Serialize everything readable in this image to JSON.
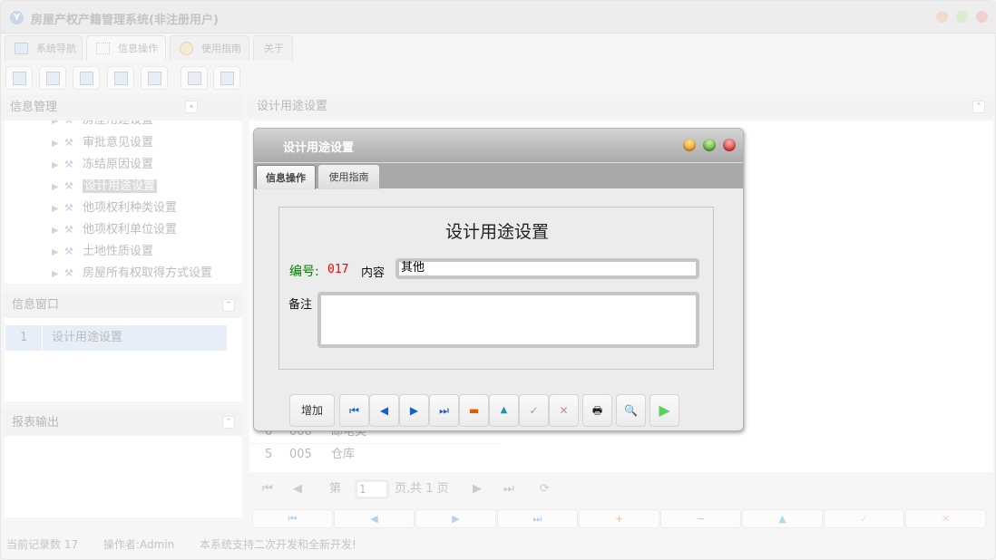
{
  "app": {
    "title": "房屋产权产籍管理系统(非注册用户)"
  },
  "tabs": [
    {
      "label": "系统导航"
    },
    {
      "label": "信息操作"
    },
    {
      "label": "使用指南"
    },
    {
      "label": "关于"
    }
  ],
  "left": {
    "info_mgmt": {
      "title": "信息管理"
    },
    "tree": [
      {
        "label": "审批意见设置"
      },
      {
        "label": "冻结原因设置"
      },
      {
        "label": "设计用途设置",
        "selected": true
      },
      {
        "label": "他项权利种类设置"
      },
      {
        "label": "他项权利单位设置"
      },
      {
        "label": "土地性质设置"
      },
      {
        "label": "房屋所有权取得方式设置"
      }
    ],
    "info_window": {
      "title": "信息窗口",
      "rows": [
        {
          "num": "1",
          "label": "设计用途设置"
        }
      ]
    },
    "report": {
      "title": "报表输出"
    }
  },
  "main": {
    "title": "设计用途设置",
    "rows": [
      {
        "num": "6",
        "code": "006",
        "name": "邮电类"
      },
      {
        "num": "5",
        "code": "005",
        "name": "仓库"
      }
    ],
    "pager": {
      "page_prefix": "第",
      "page": "1",
      "page_suffix": "页,共 1 页"
    }
  },
  "status": {
    "records": "当前记录数 17",
    "operator": "操作者:Admin",
    "message": "本系统支持二次开发和全新开发!"
  },
  "dialog": {
    "title": "设计用途设置",
    "tabs": [
      {
        "label": "信息操作"
      },
      {
        "label": "使用指南"
      }
    ],
    "form_title": "设计用途设置",
    "id_label": "编号:",
    "id_value": "017",
    "content_label": "内容",
    "content_value": "其他",
    "remark_label": "备注",
    "remark_value": "",
    "add_label": "增加",
    "colors": {
      "id_label": "#008000",
      "id_value": "#ff0000"
    }
  }
}
